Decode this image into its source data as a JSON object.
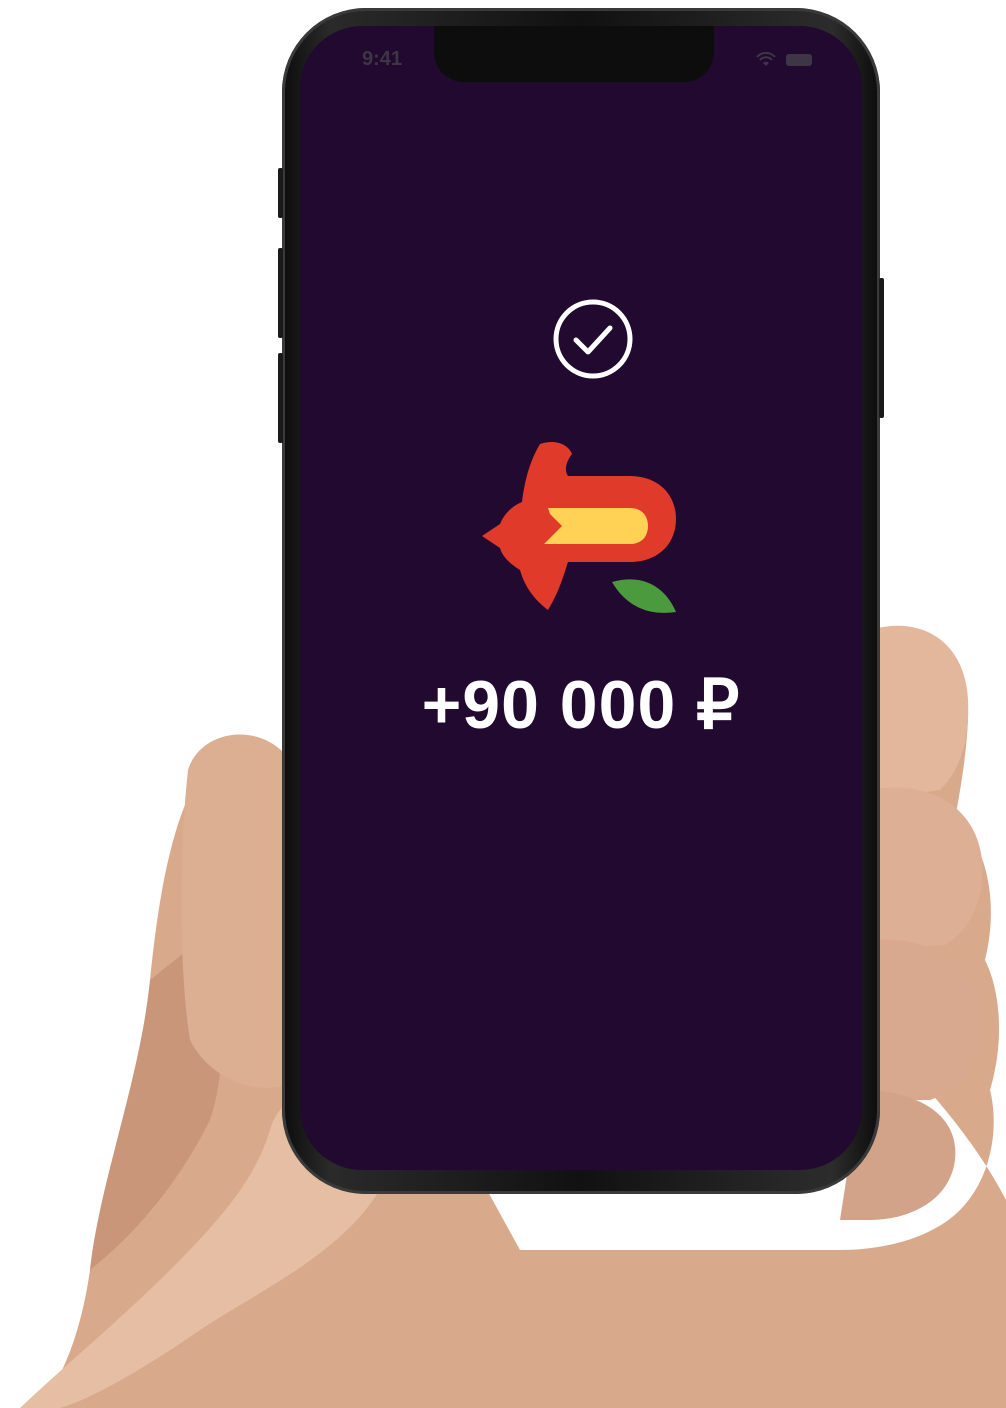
{
  "status_bar": {
    "time": "9:41",
    "wifi_icon": "wifi-icon",
    "battery_icon": "battery-icon"
  },
  "confirmation": {
    "icon": "check-circle-icon",
    "logo": "flower-ruble-logo",
    "amount": "+90 000 ₽"
  },
  "colors": {
    "screen_background": "#21092f",
    "logo_red": "#e03a2a",
    "logo_yellow": "#ffd256",
    "logo_green": "#4c9a3e",
    "text": "#ffffff"
  }
}
